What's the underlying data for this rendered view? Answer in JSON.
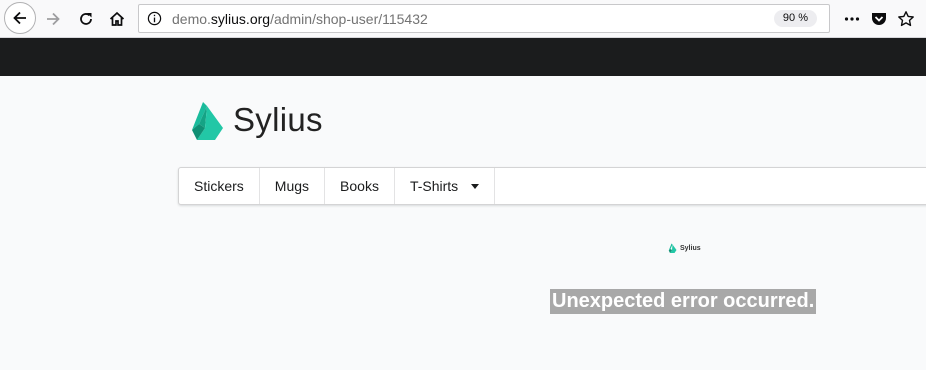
{
  "browser": {
    "url_prefix": "demo.",
    "url_host": "sylius.org",
    "url_path": "/admin/shop-user/115432",
    "zoom": "90 %"
  },
  "site": {
    "brand": "Sylius",
    "menu": [
      {
        "label": "Stickers"
      },
      {
        "label": "Mugs"
      },
      {
        "label": "Books"
      },
      {
        "label": "T-Shirts"
      }
    ],
    "small_brand": "Sylius",
    "error_message": "Unexpected error occurred.",
    "brand_color": "#1abb9c"
  }
}
